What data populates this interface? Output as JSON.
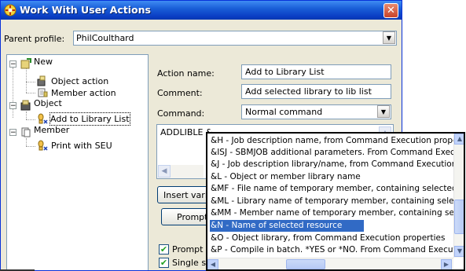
{
  "window": {
    "title": "Work With User Actions",
    "close_glyph": "✕"
  },
  "parent_profile": {
    "label": "Parent profile:",
    "value": "PhilCoulthard"
  },
  "tree": {
    "items": [
      {
        "label": "New",
        "expander": "−",
        "icon": "new-action-icon"
      },
      {
        "label": "Object action",
        "icon": "object-action-icon"
      },
      {
        "label": "Member action",
        "icon": "member-action-icon"
      },
      {
        "label": "Object",
        "expander": "−",
        "icon": "object-folder-icon"
      },
      {
        "label": "Add to Library List",
        "icon": "user-action-icon"
      },
      {
        "label": "Member",
        "expander": "−",
        "icon": "member-folder-icon"
      },
      {
        "label": "Print with SEU",
        "icon": "user-action-icon"
      }
    ]
  },
  "form": {
    "action_name_label": "Action name:",
    "action_name_value": "Add to Library List",
    "comment_label": "Comment:",
    "comment_value": "Add selected library to lib list",
    "command_label": "Command:",
    "command_type": "Normal command",
    "command_text": "ADDLIBLE &",
    "insert_button": "Insert varia",
    "prompt_button": "Prompt",
    "prompt_checkbox_label": "Prompt f",
    "single_checkbox_label": "Single se"
  },
  "variables_popup": {
    "items": [
      "&H - Job description name, from Command Execution properties",
      "&ISJ - SBMJOB additional parameters. From Command Execution properties",
      "&J - Job description library/name, from Command Execution properties",
      "&L - Object or member library name",
      "&MF - File name of temporary member, containing selected records",
      "&ML - Library name of temporary member, containing selected records",
      "&MM - Member name of temporary member, containing selected records",
      "&N - Name of selected resource",
      "&O - Object library, from Command Execution properties",
      "&P - Compile in batch. *YES or *NO. From Command Execution properties"
    ],
    "selected_index": 7
  },
  "colors": {
    "title_bar": "#0a3cc2",
    "selection": "#316ac5",
    "dialog_bg": "#ece9d8"
  }
}
